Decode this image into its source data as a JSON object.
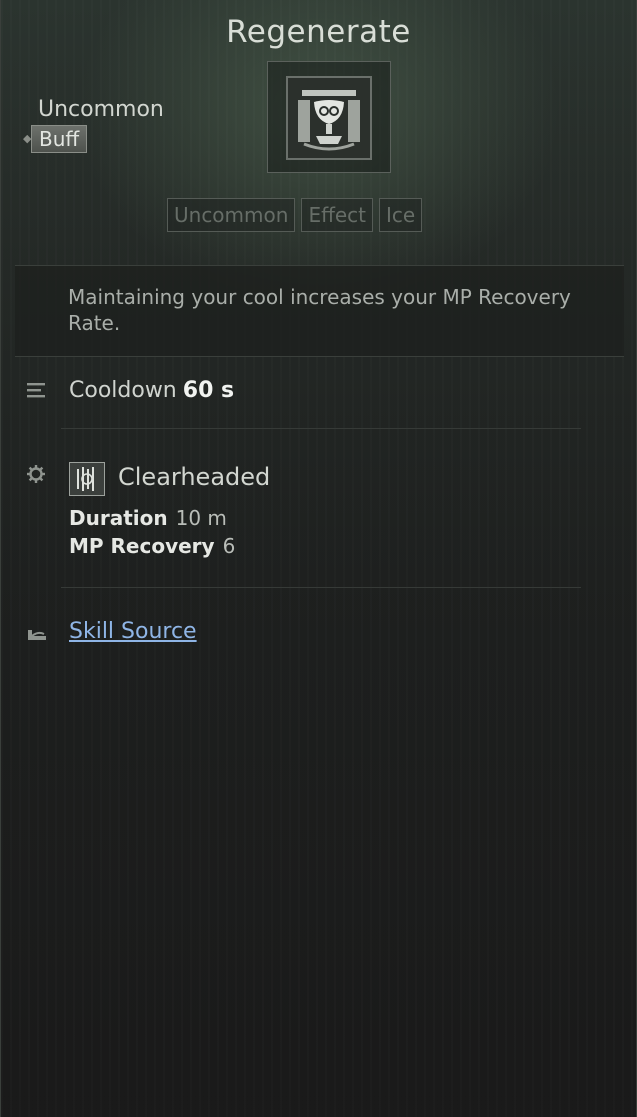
{
  "skill": {
    "title": "Regenerate",
    "rarity": "Uncommon",
    "type_badge": "Buff",
    "icon": "chalice-emblem-icon",
    "tags": [
      "Uncommon",
      "Effect",
      "Ice"
    ],
    "description": "Maintaining your cool increases your MP Recovery Rate."
  },
  "cooldown": {
    "icon": "list-icon",
    "label": "Cooldown",
    "value": "60 s"
  },
  "effect": {
    "icon": "gear-icon",
    "effect_icon": "clearheaded-effect-icon",
    "name": "Clearheaded",
    "stats": [
      {
        "label": "Duration",
        "value": "10 m"
      },
      {
        "label": "MP Recovery",
        "value": "6"
      }
    ]
  },
  "source": {
    "icon": "hand-icon",
    "label": "Skill Source"
  },
  "colors": {
    "link": "#8fb5e6",
    "tag_text": "#666d67"
  }
}
